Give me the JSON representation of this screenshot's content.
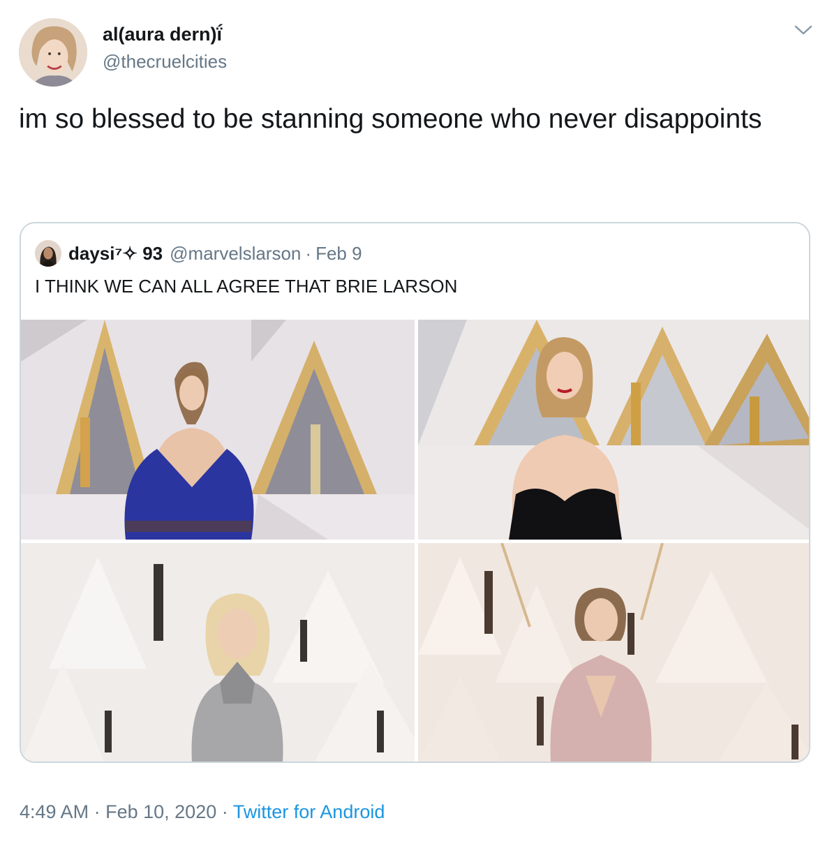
{
  "tweet": {
    "display_name": "al(aura dern)ḯ",
    "handle": "@thecruelcities",
    "text": "im so blessed to be stanning someone who never disappoints",
    "time": "4:49 AM",
    "separator": "·",
    "date": "Feb 10, 2020",
    "source": "Twitter for Android"
  },
  "quoted_tweet": {
    "display_name": "daysi⁷✧ 93",
    "handle": "@marvelslarson",
    "separator": "·",
    "date": "Feb 9",
    "text": "I THINK WE CAN ALL AGREE THAT BRIE LARSON"
  },
  "colors": {
    "text_primary": "#14171a",
    "text_secondary": "#657786",
    "link": "#1b95e0",
    "border": "#ccd6dd"
  },
  "icons": {
    "menu": "chevron-down-icon"
  }
}
